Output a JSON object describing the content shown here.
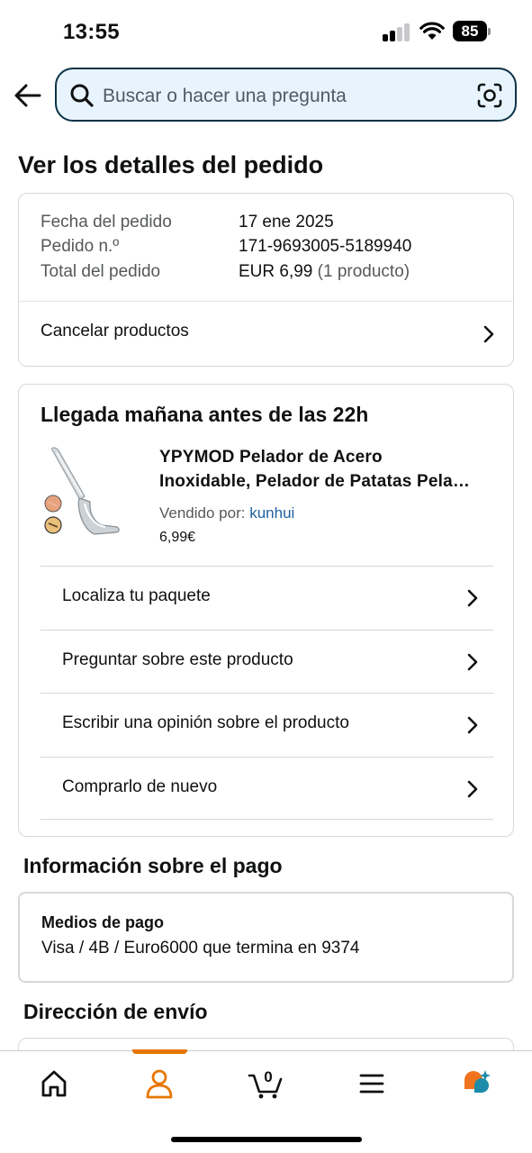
{
  "status_bar": {
    "time": "13:55",
    "battery": "85"
  },
  "search": {
    "placeholder": "Buscar o hacer una pregunta"
  },
  "page_title": "Ver los detalles del pedido",
  "order_summary": {
    "date_label": "Fecha del pedido",
    "date_value": "17 ene 2025",
    "order_number_label": "Pedido n.º",
    "order_number_value": "171-9693005-5189940",
    "total_label": "Total del pedido",
    "total_value": "EUR 6,99",
    "total_items": "(1 producto)",
    "cancel_label": "Cancelar productos"
  },
  "delivery": {
    "title": "Llegada mañana antes de las 22h",
    "product": {
      "title_line1": "YPYMOD Pelador de Acero",
      "title_line2": "Inoxidable, Pelador de Patatas Pela…",
      "sold_by_label": "Vendido por:",
      "seller": "kunhui",
      "price": "6,99€"
    },
    "actions": [
      {
        "label": "Localiza tu paquete"
      },
      {
        "label": "Preguntar sobre este producto"
      },
      {
        "label": "Escribir una opinión sobre el producto"
      },
      {
        "label": "Comprarlo de nuevo"
      }
    ]
  },
  "payment": {
    "section_title": "Información sobre el pago",
    "method_label": "Medios de pago",
    "method_value": "Visa / 4B / Euro6000  que termina en 9374"
  },
  "shipping": {
    "section_title": "Dirección de envío"
  },
  "tab_bar": {
    "cart_count": "0",
    "active_tab": "account",
    "accent_color": "#e77600",
    "tabs": [
      "home-icon",
      "account-icon",
      "cart-icon",
      "menu-icon",
      "rufus-icon"
    ]
  },
  "colors": {
    "search_bg": "#e7f4fd",
    "search_border": "#0c3247",
    "link": "#2162a1"
  }
}
